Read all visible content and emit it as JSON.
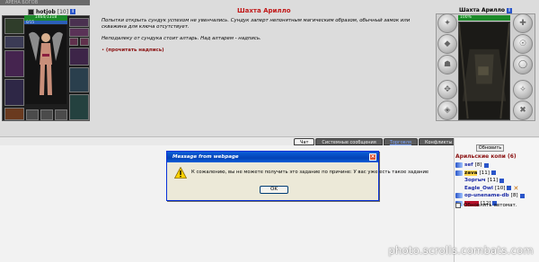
{
  "top": {
    "banner": "АРЕНА БОГОВ",
    "player": {
      "name": "hotjob",
      "level": "[10]"
    },
    "hp": "1464/1318",
    "mp": "0/15",
    "location_title": "Шахта Арилло",
    "story": [
      "Попытки открыть сундук успехом не увенчались. Сундук заперт непонятным магическим образом, обычный замок или скважина для ключа отсутствует.",
      "Неподалеку от сундука стоит алтарь. Над алтарем - надпись."
    ],
    "action_link": "(прочитать надпись)",
    "map_caption": "Шахта Арилло",
    "map_hp": "100%"
  },
  "tabs": [
    "Чат",
    "Системные сообщения",
    "Торговля",
    "Конфликты"
  ],
  "online": {
    "refresh_label": "Обновить",
    "title": "Арильские копи (6)",
    "users": [
      {
        "name": "sef",
        "level": "[8]"
      },
      {
        "name": "zava",
        "level": "[11]"
      },
      {
        "name": "Зоргыч",
        "level": "[11]"
      },
      {
        "name": "Eagle_Owl",
        "level": "[10]"
      },
      {
        "name": "op-unename-db",
        "level": "[8]"
      },
      {
        "name": "",
        "level": "[12]"
      }
    ],
    "auto_refresh_label": "Обновлять автомат."
  },
  "dialog": {
    "title": "Message from webpage",
    "message": "К сожалению, вы не можете получить это задание по причине: У вас уже есть такое задание",
    "ok_label": "OK"
  },
  "watermark": "photo.scrolls.combats.com"
}
